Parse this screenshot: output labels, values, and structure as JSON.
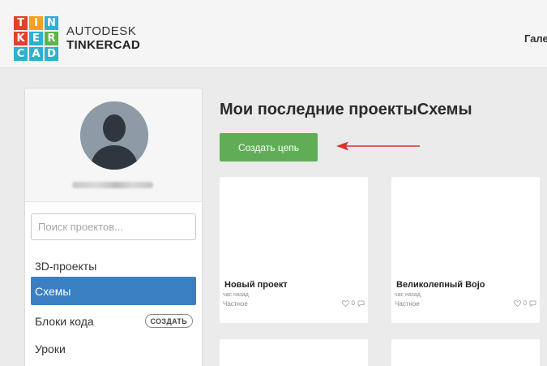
{
  "header": {
    "logo_letters": [
      "T",
      "I",
      "N",
      "K",
      "E",
      "R",
      "C",
      "A",
      "D"
    ],
    "logo_colors": [
      "#e2412b",
      "#f4a024",
      "#2fb0d1",
      "#e2412b",
      "#2fb0d1",
      "#5fb347",
      "#2fb0d1",
      "#2fb0d1",
      "#2fb0d1"
    ],
    "brand_top": "AUTODESK",
    "brand_bottom": "TINKERCAD",
    "nav_gallery": "Гале"
  },
  "sidebar": {
    "search_placeholder": "Поиск проектов...",
    "items": [
      {
        "label": "3D-проекты",
        "active": false
      },
      {
        "label": "Схемы",
        "active": true
      },
      {
        "label": "Блоки кода",
        "active": false,
        "badge": "СОЗДАТЬ"
      },
      {
        "label": "Уроки",
        "active": false
      }
    ],
    "active_color": "#3a7fc1"
  },
  "main": {
    "title": "Мои последние проектыСхемы",
    "create_button": "Создать цепь",
    "create_button_color": "#5fae57",
    "arrow_color": "#d9322b",
    "projects": [
      {
        "title": "Новый проект",
        "time": "час назад",
        "privacy": "Частное",
        "likes": "0",
        "comments": ""
      },
      {
        "title": "Великолепный Bojo",
        "time": "час назад",
        "privacy": "Частное",
        "likes": "0",
        "comments": ""
      }
    ]
  }
}
